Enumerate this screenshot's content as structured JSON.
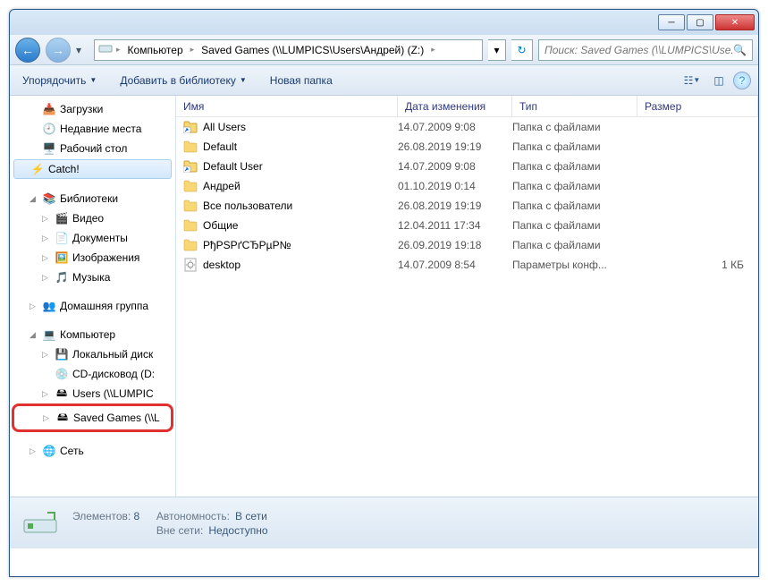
{
  "breadcrumbs": {
    "root": "Компьютер",
    "path": "Saved Games (\\\\LUMPICS\\Users\\Андрей) (Z:)"
  },
  "search": {
    "placeholder": "Поиск: Saved Games (\\\\LUMPICS\\Use..."
  },
  "toolbar": {
    "organize": "Упорядочить",
    "addlib": "Добавить в библиотеку",
    "newfolder": "Новая папка"
  },
  "sidebar": {
    "downloads": "Загрузки",
    "recent": "Недавние места",
    "desktop": "Рабочий стол",
    "catch": "Catch!",
    "libraries": "Библиотеки",
    "video": "Видео",
    "documents": "Документы",
    "pictures": "Изображения",
    "music": "Музыка",
    "homegroup": "Домашняя группа",
    "computer": "Компьютер",
    "localdisk": "Локальный диск",
    "cdrom": "CD-дисковод (D:",
    "users": "Users (\\\\LUMPIC",
    "savedgames": "Saved Games (\\\\L",
    "network": "Сеть"
  },
  "columns": {
    "name": "Имя",
    "date": "Дата изменения",
    "type": "Тип",
    "size": "Размер"
  },
  "files": [
    {
      "name": "All Users",
      "date": "14.07.2009 9:08",
      "type": "Папка с файлами",
      "size": "",
      "kind": "link"
    },
    {
      "name": "Default",
      "date": "26.08.2019 19:19",
      "type": "Папка с файлами",
      "size": "",
      "kind": "folder"
    },
    {
      "name": "Default User",
      "date": "14.07.2009 9:08",
      "type": "Папка с файлами",
      "size": "",
      "kind": "link"
    },
    {
      "name": "Андрей",
      "date": "01.10.2019 0:14",
      "type": "Папка с файлами",
      "size": "",
      "kind": "folder"
    },
    {
      "name": "Все пользователи",
      "date": "26.08.2019 19:19",
      "type": "Папка с файлами",
      "size": "",
      "kind": "folder"
    },
    {
      "name": "Общие",
      "date": "12.04.2011 17:34",
      "type": "Папка с файлами",
      "size": "",
      "kind": "folder"
    },
    {
      "name": "РђРЅРґСЂРµР№",
      "date": "26.09.2019 19:18",
      "type": "Папка с файлами",
      "size": "",
      "kind": "folder"
    },
    {
      "name": "desktop",
      "date": "14.07.2009 8:54",
      "type": "Параметры конф...",
      "size": "1 КБ",
      "kind": "ini"
    }
  ],
  "status": {
    "elements_lbl": "Элементов: ",
    "elements_val": "8",
    "autonomy_lbl": "Автономность:",
    "autonomy_val": "В сети",
    "offline_lbl": "Вне сети:",
    "offline_val": "Недоступно"
  }
}
